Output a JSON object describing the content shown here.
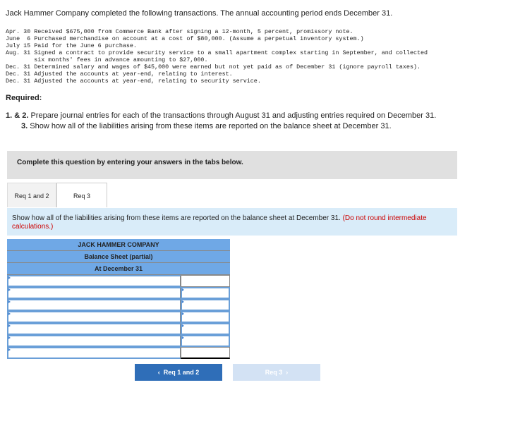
{
  "intro": "Jack Hammer Company completed the following transactions. The annual accounting period ends December 31.",
  "transactions": "Apr. 30 Received $675,000 from Commerce Bank after signing a 12-month, 5 percent, promissory note.\nJune  6 Purchased merchandise on account at a cost of $80,000. (Assume a perpetual inventory system.)\nJuly 15 Paid for the June 6 purchase.\nAug. 31 Signed a contract to provide security service to a small apartment complex starting in September, and collected\n        six months' fees in advance amounting to $27,000.\nDec. 31 Determined salary and wages of $45,000 were earned but not yet paid as of December 31 (ignore payroll taxes).\nDec. 31 Adjusted the accounts at year-end, relating to interest.\nDec. 31 Adjusted the accounts at year-end, relating to security service.",
  "required_label": "Required:",
  "req_1_2": "1. & 2. Prepare journal entries for each of the transactions through August 31 and adjusting entries required on December 31.",
  "req_3": "3. Show how all of the liabilities arising from these items are reported on the balance sheet at December 31.",
  "band": "Complete this question by entering your answers in the tabs below.",
  "tabs": [
    {
      "label": "Req 1 and 2"
    },
    {
      "label": "Req 3"
    }
  ],
  "instruction": "Show how all of the liabilities arising from these items are reported on the balance sheet at December 31.",
  "instruction_note": "(Do not round intermediate calculations.)",
  "table": {
    "company": "JACK HAMMER COMPANY",
    "statement": "Balance Sheet (partial)",
    "date": "At December 31"
  },
  "nav": {
    "prev": "Req 1 and 2",
    "next": "Req 3"
  }
}
